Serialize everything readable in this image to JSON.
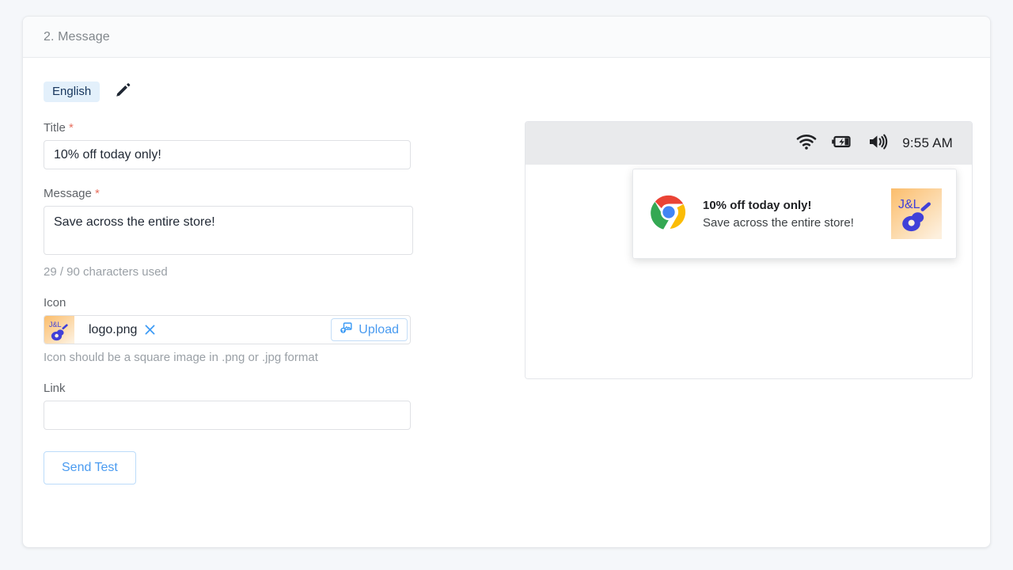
{
  "card": {
    "header_title": "2. Message"
  },
  "form": {
    "language_badge": "English",
    "edit_icon": "pencil-icon",
    "title": {
      "label": "Title",
      "required_mark": "*",
      "value": "10% off today only!",
      "placeholder": ""
    },
    "message": {
      "label": "Message",
      "required_mark": "*",
      "value": "Save across the entire store!",
      "placeholder": "",
      "counter": "29 / 90 characters used"
    },
    "icon": {
      "label": "Icon",
      "filename": "logo.png",
      "remove_icon": "close-icon",
      "upload_label": "Upload",
      "upload_icon": "image-upload-icon",
      "helper": "Icon should be a square image in .png or .jpg format"
    },
    "link": {
      "label": "Link",
      "value": "",
      "placeholder": ""
    },
    "send_test_label": "Send Test"
  },
  "preview": {
    "status_bar": {
      "wifi_icon": "wifi-icon",
      "battery_icon": "battery-charging-icon",
      "volume_icon": "volume-icon",
      "time": "9:55 AM"
    },
    "notification": {
      "app_icon": "chrome-icon",
      "title": "10% off today only!",
      "body": "Save across the entire store!",
      "logo_icon": "jl-guitar-logo",
      "logo_text": "J&L"
    }
  },
  "colors": {
    "page_bg": "#f5f7fa",
    "card_bg": "#ffffff",
    "header_bg": "#fafbfc",
    "accent_blue": "#4a9bf0",
    "badge_bg": "#e3f0fb",
    "badge_text": "#17365d",
    "required_red": "#e8705f",
    "muted_text": "#9aa0a6",
    "label_text": "#5f6368",
    "status_bar_bg": "#e9eaec",
    "logo_bg_start": "#fbbd6b",
    "logo_bg_end": "#fdefdc",
    "logo_fg": "#4040d8"
  }
}
